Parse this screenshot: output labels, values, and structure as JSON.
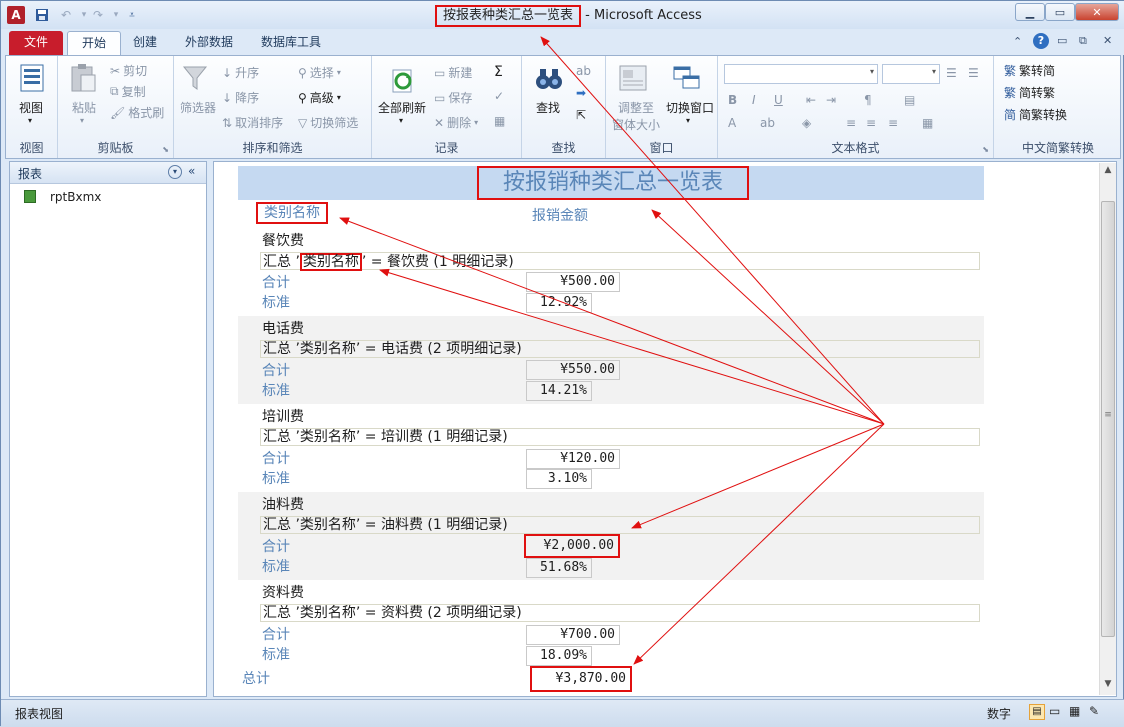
{
  "window": {
    "title_doc": "按报表种类汇总一览表",
    "title_sep": " - ",
    "title_app": "Microsoft Access"
  },
  "tabs": [
    {
      "label": "文件"
    },
    {
      "label": "开始"
    },
    {
      "label": "创建"
    },
    {
      "label": "外部数据"
    },
    {
      "label": "数据库工具"
    }
  ],
  "ribbon": {
    "groups": {
      "view": "视图",
      "clipboard": "剪贴板",
      "sort_filter": "排序和筛选",
      "records": "记录",
      "find": "查找",
      "window": "窗口",
      "text_format": "文本格式",
      "chinese_conv": "中文简繁转换"
    },
    "buttons": {
      "view": "视图",
      "paste": "粘贴",
      "cut": "剪切",
      "copy": "复制",
      "format_painter": "格式刷",
      "filter": "筛选器",
      "ascending": "升序",
      "descending": "降序",
      "remove_sort": "取消排序",
      "selection": "选择",
      "advanced": "高级",
      "toggle_filter": "切换筛选",
      "refresh_all": "全部刷新",
      "new": "新建",
      "save": "保存",
      "delete": "删除",
      "find": "查找",
      "resize_line1": "调整至",
      "resize_line2": "窗体大小",
      "switch_window": "切换窗口",
      "t2s": "繁转简",
      "s2t": "简转繁",
      "conv": "简繁转换"
    }
  },
  "nav": {
    "header": "报表",
    "items": [
      {
        "label": "rptBxmx"
      }
    ]
  },
  "report": {
    "title": "按报销种类汇总一览表",
    "col_category": "类别名称",
    "col_amount": "报销金额",
    "sum_label": "合计",
    "std_label": "标准",
    "groups": [
      {
        "name": "餐饮费",
        "summary_prefix": "汇总 ’",
        "summary_field": "类别名称",
        "summary_rest": "’ =  餐饮费 (1 明细记录)",
        "total": "¥500.00",
        "percent": "12.92%"
      },
      {
        "name": "电话费",
        "summary_prefix": "汇总 ’",
        "summary_field": "类别名称",
        "summary_rest": "’ =  电话费 (2 项明细记录)",
        "total": "¥550.00",
        "percent": "14.21%"
      },
      {
        "name": "培训费",
        "summary_prefix": "汇总 ’",
        "summary_field": "类别名称",
        "summary_rest": "’ =  培训费 (1 明细记录)",
        "total": "¥120.00",
        "percent": "3.10%"
      },
      {
        "name": "油料费",
        "summary_prefix": "汇总 ’",
        "summary_field": "类别名称",
        "summary_rest": "’ =  油料费 (1 明细记录)",
        "total": "¥2,000.00",
        "percent": "51.68%"
      },
      {
        "name": "资料费",
        "summary_prefix": "汇总 ’",
        "summary_field": "类别名称",
        "summary_rest": "’ =  资料费 (2 项明细记录)",
        "total": "¥700.00",
        "percent": "18.09%"
      }
    ],
    "grand_label": "总计",
    "grand_total": "¥3,870.00"
  },
  "status": {
    "left": "报表视图",
    "numlock": "数字"
  },
  "colors": {
    "annotation": "#e01010",
    "title_band": "#c5d9f1",
    "file_tab": "#c81d2c"
  }
}
